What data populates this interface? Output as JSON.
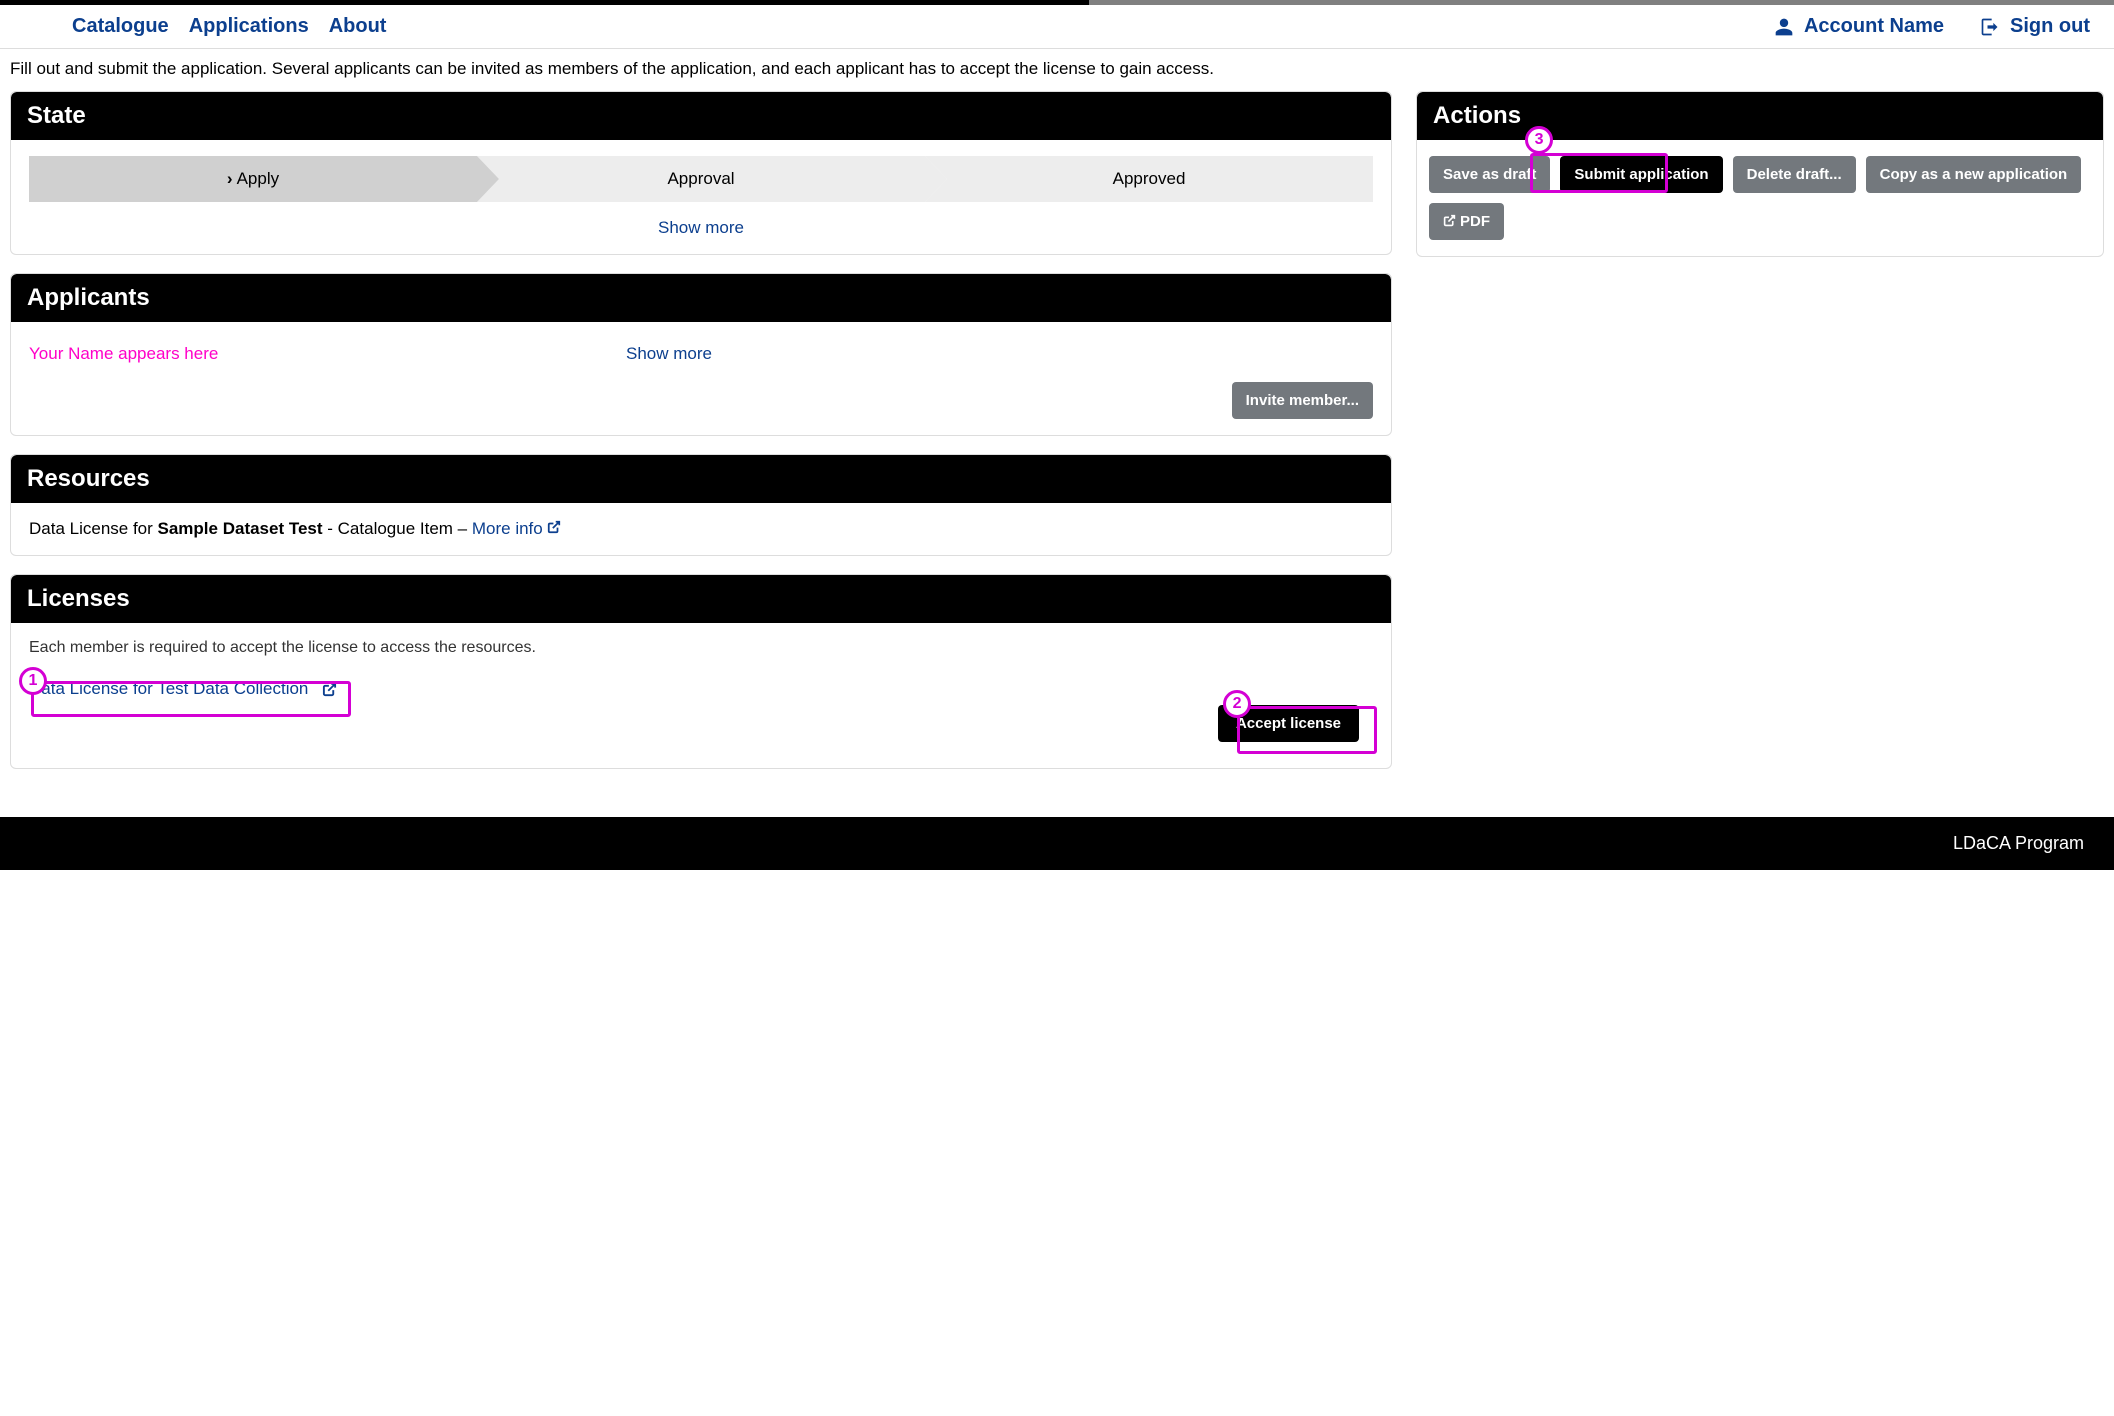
{
  "nav": {
    "catalogue": "Catalogue",
    "applications": "Applications",
    "about": "About",
    "account": "Account Name",
    "signout": "Sign out"
  },
  "intro": "Fill out and submit the application. Several applicants can be invited as members of the application, and each applicant has to accept the license to gain access.",
  "state": {
    "title": "State",
    "step1": "Apply",
    "step2": "Approval",
    "step3": "Approved",
    "showmore": "Show more"
  },
  "applicants": {
    "title": "Applicants",
    "name": "Your Name appears here",
    "showmore": "Show more",
    "invite": "Invite member..."
  },
  "resources": {
    "title": "Resources",
    "prefix": "Data License for  ",
    "dataset": "Sample Dataset Test",
    "middle": "    - Catalogue Item – ",
    "moreinfo": "More info"
  },
  "licenses": {
    "title": "Licenses",
    "desc": "Each member is required to accept the license to access the resources.",
    "link": "Data License for  Test Data Collection",
    "accept": "Accept license"
  },
  "actions": {
    "title": "Actions",
    "save": "Save as draft",
    "submit": "Submit application",
    "delete": "Delete draft...",
    "copy": "Copy as a new application",
    "pdf": "PDF"
  },
  "annotations": {
    "a1": "1",
    "a2": "2",
    "a3": "3"
  },
  "footer": "LDaCA Program"
}
